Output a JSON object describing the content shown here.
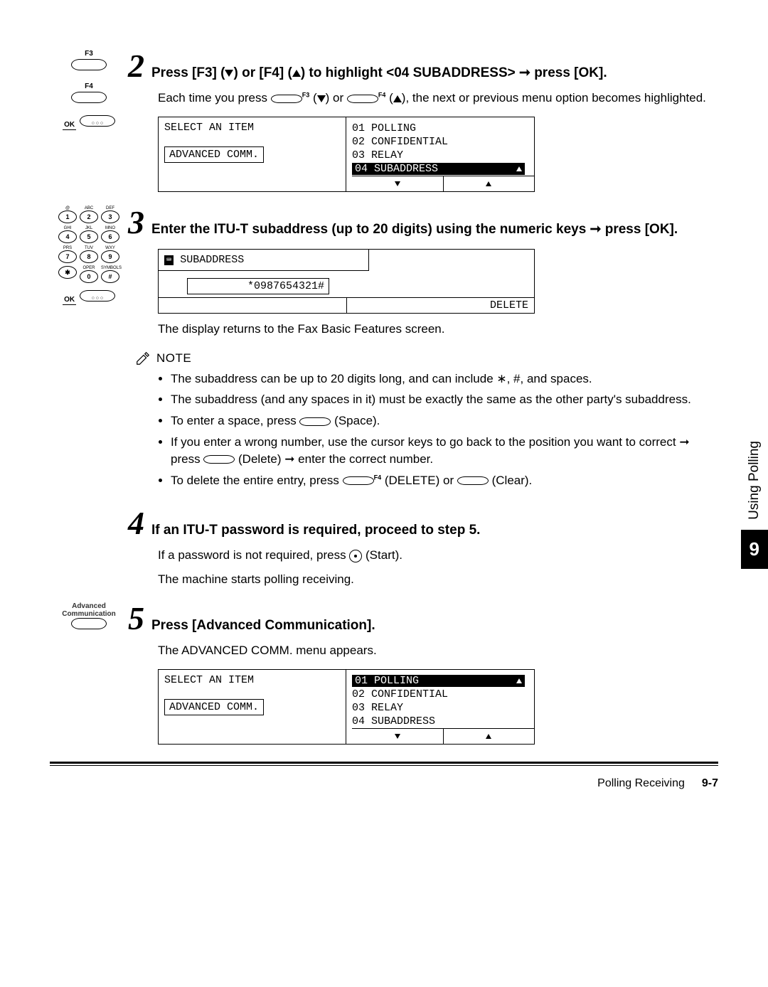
{
  "sideTab": {
    "label": "Using Polling",
    "chapter": "9"
  },
  "footer": {
    "section": "Polling Receiving",
    "page": "9-7"
  },
  "buttons": {
    "f3": "F3",
    "f4": "F4",
    "ok": "OK",
    "advComm": "Advanced\nCommunication"
  },
  "step2": {
    "num": "2",
    "title_a": "Press [F3] (",
    "title_b": ") or [F4] (",
    "title_c": ") to highlight <04 SUBADDRESS> ➞ press [OK].",
    "desc_a": "Each time you press ",
    "desc_b": " (",
    "desc_c": ") or ",
    "desc_d": " (",
    "desc_e": "), the next or previous menu option becomes highlighted.",
    "lcd": {
      "leftTitle": "SELECT AN ITEM",
      "leftBox": "ADVANCED COMM.",
      "rows": [
        "01  POLLING",
        "02  CONFIDENTIAL",
        "03  RELAY",
        "04  SUBADDRESS"
      ],
      "highlightIndex": 3
    }
  },
  "step3": {
    "num": "3",
    "title": "Enter the ITU-T subaddress (up to 20 digits) using the numeric keys ➞ press [OK].",
    "lcd": {
      "header": "SUBADDRESS",
      "input": "*0987654321#",
      "delete": "DELETE"
    },
    "afterLcd": "The display returns to the Fax Basic Features screen.",
    "noteLabel": "NOTE",
    "notes": {
      "n1": "The subaddress can be up to 20 digits long, and can include ∗, #, and spaces.",
      "n2": "The subaddress (and any spaces in it) must be exactly the same as the other party's subaddress.",
      "n3a": "To enter a space, press ",
      "n3b": " (Space).",
      "n4a": "If you enter a wrong number, use the cursor keys to go back to the position you want to correct ➞ press ",
      "n4b": " (Delete) ➞ enter the correct number.",
      "n5a": "To delete the entire entry, press ",
      "n5b": " (DELETE) or ",
      "n5c": " (Clear)."
    }
  },
  "step4": {
    "num": "4",
    "title": "If an ITU-T password is required, proceed to step 5.",
    "l1a": "If a password is not required, press ",
    "l1b": " (Start).",
    "l2": "The machine starts polling receiving."
  },
  "step5": {
    "num": "5",
    "title": "Press [Advanced Communication].",
    "desc": "The ADVANCED COMM. menu appears.",
    "lcd": {
      "leftTitle": "SELECT AN ITEM",
      "leftBox": "ADVANCED COMM.",
      "rows": [
        "01  POLLING",
        "02  CONFIDENTIAL",
        "03  RELAY",
        "04  SUBADDRESS"
      ],
      "highlightIndex": 0
    }
  },
  "keypad": {
    "labels": [
      "@",
      "ABC",
      "DEF",
      "GHI",
      "JKL",
      "MNO",
      "PRS",
      "TUV",
      "WXY",
      "",
      "OPER",
      "SYMBOLS"
    ],
    "keys": [
      "1",
      "2",
      "3",
      "4",
      "5",
      "6",
      "7",
      "8",
      "9",
      "✱",
      "0",
      "#"
    ]
  }
}
